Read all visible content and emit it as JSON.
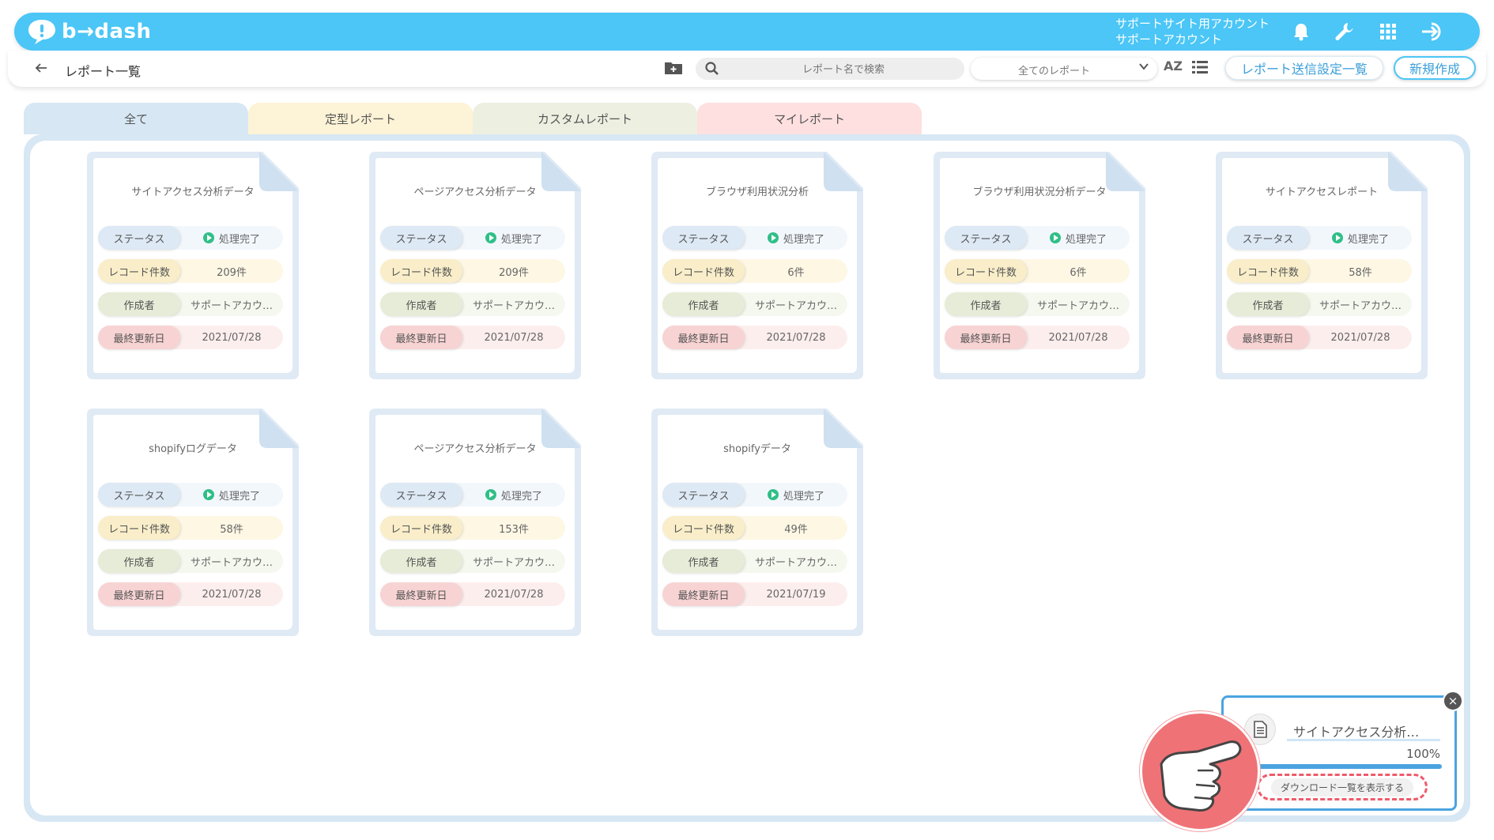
{
  "header": {
    "logo_text": "b→dash",
    "account_line1": "サポートサイト用アカウント",
    "account_line2": "サポートアカウント",
    "icons": [
      "bell-icon",
      "wrench-icon",
      "apps-grid-icon",
      "logout-icon"
    ]
  },
  "toolbar": {
    "back_icon": "arrow-left-icon",
    "page_title": "レポート一覧",
    "search_placeholder": "レポート名で検索",
    "filter_value": "全てのレポート",
    "sort_label": "AZ",
    "send_settings_label": "レポート送信設定一覧",
    "new_label": "新規作成"
  },
  "tabs": [
    {
      "label": "全て",
      "color": "#d7e7f4"
    },
    {
      "label": "定型レポート",
      "color": "#fdf3d6"
    },
    {
      "label": "カスタムレポート",
      "color": "#edf0e1"
    },
    {
      "label": "マイレポート",
      "color": "#fde0df"
    }
  ],
  "field_labels": {
    "status": "ステータス",
    "count": "レコード件数",
    "author": "作成者",
    "date": "最終更新日"
  },
  "cards": [
    {
      "title": "サイトアクセス分析データ",
      "status": "処理完了",
      "count": "209件",
      "author": "サポートアカウ…",
      "date": "2021/07/28"
    },
    {
      "title": "ページアクセス分析データ",
      "status": "処理完了",
      "count": "209件",
      "author": "サポートアカウ…",
      "date": "2021/07/28"
    },
    {
      "title": "ブラウザ利用状況分析",
      "status": "処理完了",
      "count": "6件",
      "author": "サポートアカウ…",
      "date": "2021/07/28"
    },
    {
      "title": "ブラウザ利用状況分析データ",
      "status": "処理完了",
      "count": "6件",
      "author": "サポートアカウ…",
      "date": "2021/07/28"
    },
    {
      "title": "サイトアクセスレポート",
      "status": "処理完了",
      "count": "58件",
      "author": "サポートアカウ…",
      "date": "2021/07/28"
    },
    {
      "title": "shopifyログデータ",
      "status": "処理完了",
      "count": "58件",
      "author": "サポートアカウ…",
      "date": "2021/07/28"
    },
    {
      "title": "ページアクセス分析データ",
      "status": "処理完了",
      "count": "153件",
      "author": "サポートアカウ…",
      "date": "2021/07/28"
    },
    {
      "title": "shopifyデータ",
      "status": "処理完了",
      "count": "49件",
      "author": "サポートアカウ…",
      "date": "2021/07/19"
    }
  ],
  "download_popup": {
    "file_name": "サイトアクセス分析…",
    "progress_text": "100%",
    "progress": 1.0,
    "button_label": "ダウンロード一覧を表示する"
  }
}
